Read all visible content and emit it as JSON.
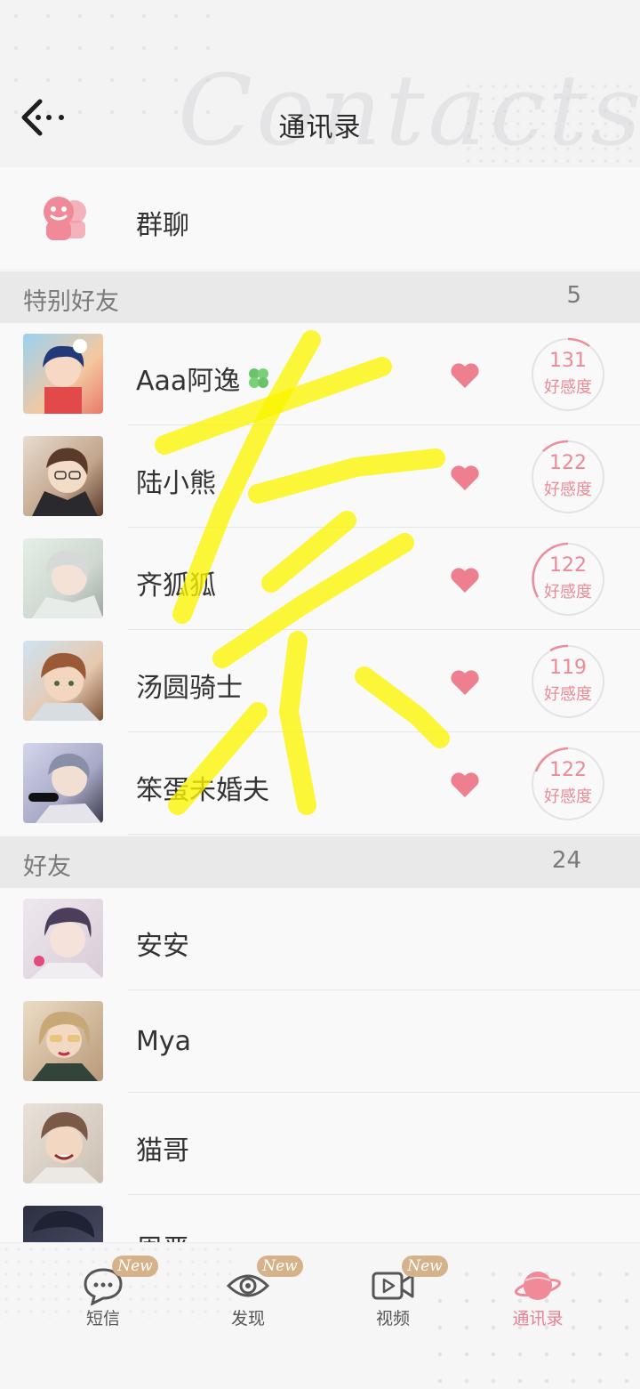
{
  "header": {
    "title": "通讯录",
    "watermark": "Contacts"
  },
  "group_chat": {
    "label": "群聊"
  },
  "special_section": {
    "label": "特别好友",
    "count": "5"
  },
  "special_friends": [
    {
      "name": "Aaa阿逸",
      "badge_icon": "clover-icon",
      "affinity": "131",
      "affinity_label": "好感度",
      "affinity_progress": 0.1
    },
    {
      "name": "陆小熊",
      "affinity": "122",
      "affinity_label": "好感度",
      "affinity_progress": 0.1
    },
    {
      "name": "齐狐狐",
      "affinity": "122",
      "affinity_label": "好感度",
      "affinity_progress": 0.1
    },
    {
      "name": "汤圆骑士",
      "affinity": "119",
      "affinity_label": "好感度",
      "affinity_progress": 0.05
    },
    {
      "name": "笨蛋未婚夫",
      "affinity": "122",
      "affinity_label": "好感度",
      "affinity_progress": 0.1
    }
  ],
  "friends_section": {
    "label": "好友",
    "count": "24"
  },
  "friends": [
    {
      "name": "安安"
    },
    {
      "name": "Mya"
    },
    {
      "name": "猫哥"
    },
    {
      "name": "周严"
    }
  ],
  "bottom_nav": [
    {
      "label": "短信",
      "icon": "message-bubble-icon",
      "badge": "New",
      "active": false
    },
    {
      "label": "发现",
      "icon": "eye-icon",
      "badge": "New",
      "active": false
    },
    {
      "label": "视频",
      "icon": "video-icon",
      "badge": "New",
      "active": false
    },
    {
      "label": "通讯录",
      "icon": "planet-icon",
      "active": true
    }
  ],
  "colors": {
    "accent_pink": "#ee7e90",
    "heart": "#ee7f8e",
    "badge_gold": "#d5b28a",
    "scribble_yellow": "#fbf500"
  }
}
